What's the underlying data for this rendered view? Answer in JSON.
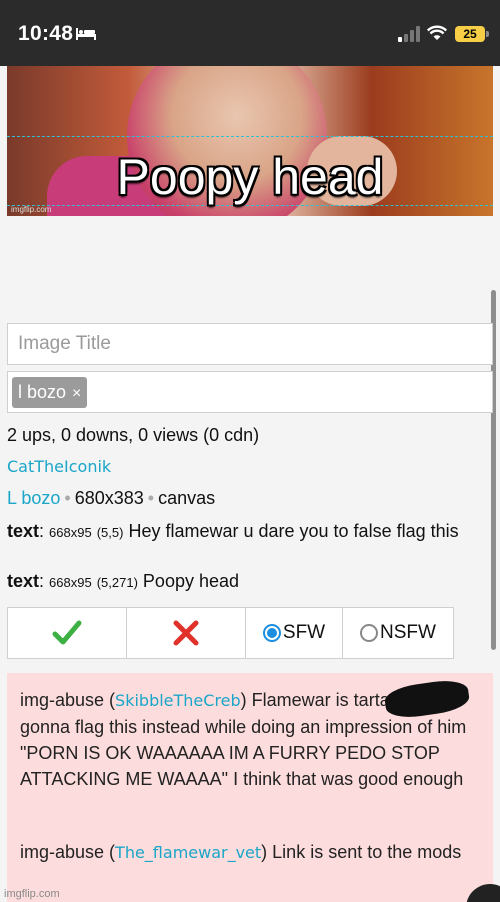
{
  "status_bar": {
    "time": "10:48",
    "battery": "25",
    "icons": [
      "bed-icon",
      "cellular-signal-icon",
      "wifi-icon",
      "battery-icon"
    ]
  },
  "meme": {
    "caption": "Poopy head",
    "watermark": "imgflip.com"
  },
  "form": {
    "title_placeholder": "Image Title",
    "title_value": "",
    "tag": "l bozo",
    "tag_remove": "×"
  },
  "info": {
    "stats": "2 ups, 0 downs, 0 views (0 cdn)",
    "author": "CatTheIconik",
    "tag_link": "L bozo",
    "dimensions": "680x383",
    "kind": "canvas"
  },
  "text_boxes": [
    {
      "label": "text",
      "size": "668x95",
      "pos": "(5,5)",
      "content": "Hey flamewar u dare you to false flag this"
    },
    {
      "label": "text",
      "size": "668x95",
      "pos": "(5,271)",
      "content": "Poopy head"
    }
  ],
  "moderation": {
    "approve_icon": "check-icon",
    "disapprove_icon": "x-icon",
    "sfw_label": "SFW",
    "nsfw_label": "NSFW",
    "selected": "SFW",
    "colors": {
      "approve": "#3cb043",
      "disapprove": "#e0312b",
      "radio": "#1c8fe0"
    }
  },
  "comments": [
    {
      "prefix": "img-abuse (",
      "user": "SkibbleTheCreb",
      "text": ") Flamewar is        tartar so I'm gonna flag this instead while doing an impression of him \"PORN IS OK WAAAAAA IM A FURRY PEDO STOP ATTACKING ME WAAAA\" I think that was good enough"
    },
    {
      "prefix": "img-abuse (",
      "user": "The_flamewar_vet",
      "text": ") Link is sent to the mods"
    }
  ],
  "footer": {
    "watermark": "imgflip.com"
  },
  "colors": {
    "link": "#1aa6c8",
    "comment_bg": "#fcdcdc",
    "status_bg": "#2b2b2b"
  }
}
